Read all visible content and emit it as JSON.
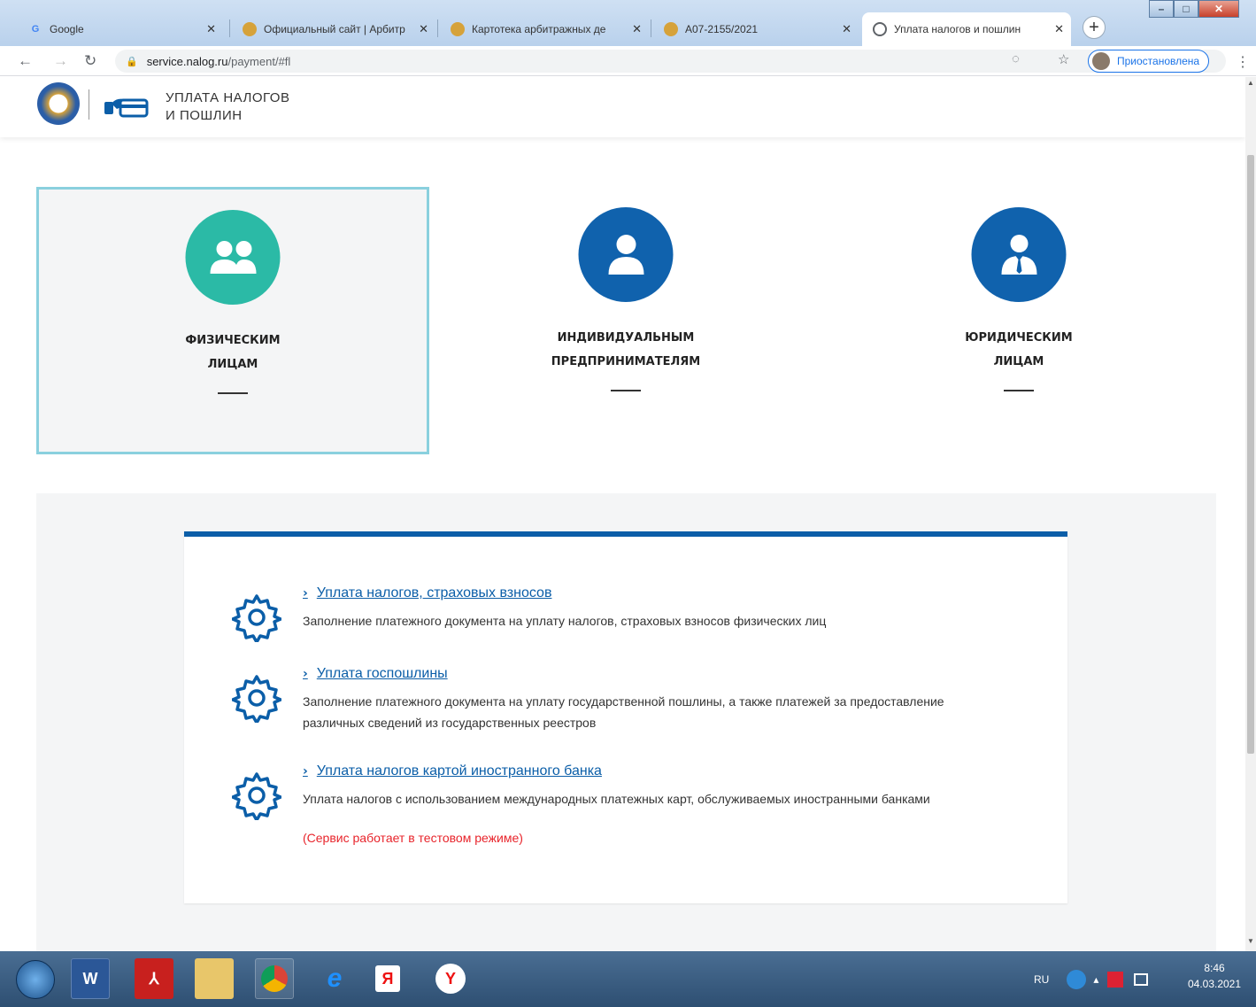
{
  "browser": {
    "tabs": [
      {
        "title": "Google",
        "favicon": "G"
      },
      {
        "title": "Официальный сайт | Арбитр",
        "favicon": "emblem"
      },
      {
        "title": "Картотека арбитражных де",
        "favicon": "emblem"
      },
      {
        "title": "А07-2155/2021",
        "favicon": "emblem"
      },
      {
        "title": "Уплата налогов и пошлин",
        "favicon": "globe"
      }
    ],
    "url_host": "service.nalog.ru",
    "url_path": "/payment/#fl",
    "profile_label": "Приостановлена"
  },
  "site": {
    "title_line1": "УПЛАТА НАЛОГОВ",
    "title_line2": "И ПОШЛИН"
  },
  "categories": [
    {
      "line1": "ФИЗИЧЕСКИМ",
      "line2": "ЛИЦАМ",
      "color": "#2bbaa6",
      "icon": "two-users-icon",
      "selected": true
    },
    {
      "line1": "ИНДИВИДУАЛЬНЫМ",
      "line2": "ПРЕДПРИНИМАТЕЛЯМ",
      "color": "#1062ad",
      "icon": "user-icon",
      "selected": false
    },
    {
      "line1": "ЮРИДИЧЕСКИМ",
      "line2": "ЛИЦАМ",
      "color": "#1062ad",
      "icon": "businessman-icon",
      "selected": false
    }
  ],
  "services": [
    {
      "link": "Уплата налогов, страховых взносов",
      "desc": "Заполнение платежного документа на уплату налогов, страховых взносов физических лиц"
    },
    {
      "link": "Уплата госпошлины",
      "desc": "Заполнение платежного документа на уплату государственной пошлины, а также платежей за предоставление различных сведений из государственных реестров"
    },
    {
      "link": "Уплата налогов картой иностранного банка",
      "desc": "Уплата налогов с использованием международных платежных карт, обслуживаемых иностранными банками",
      "note": "(Сервис работает в тестовом режиме)"
    }
  ],
  "taskbar": {
    "lang": "RU",
    "time": "8:46",
    "date": "04.03.2021"
  }
}
